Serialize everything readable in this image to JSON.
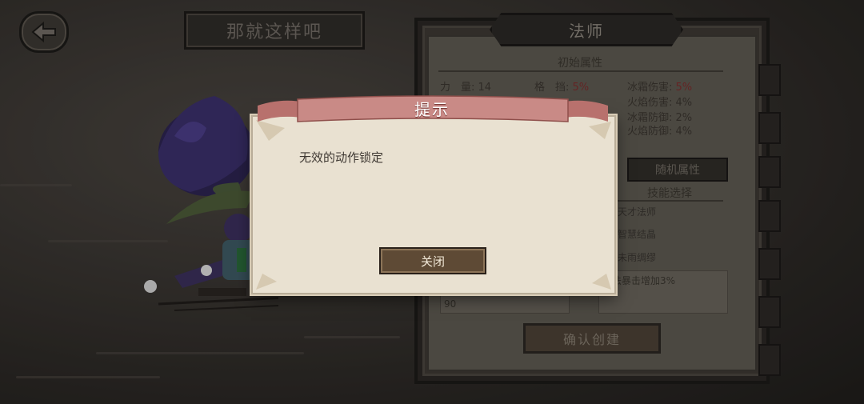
{
  "header": {
    "back_icon": "back-arrow-icon",
    "title": "那就这样吧"
  },
  "panel": {
    "class_name": "法师",
    "initial_attrs_title": "初始属性",
    "stats_left": [
      {
        "label": "力　量:",
        "value": "14"
      },
      {
        "label": "",
        "value": ""
      }
    ],
    "stats_mid": [
      {
        "label": "格　挡:",
        "value": "5%"
      }
    ],
    "stats_right": [
      {
        "label": "冰霜伤害:",
        "value": "5%"
      },
      {
        "label": "火焰伤害:",
        "value": "4%"
      },
      {
        "label": "冰霜防御:",
        "value": "2%"
      },
      {
        "label": "火焰防御:",
        "value": "4%"
      }
    ],
    "random_button": "随机属性",
    "skills_title": "技能选择",
    "skills": [
      "天才法师",
      "智慧结晶",
      "未雨绸缪"
    ],
    "skill_desc": "魔法暴击增加3%",
    "left_desc_value": "90",
    "confirm_button": "确认创建"
  },
  "dialog": {
    "title": "提示",
    "message": "无效的动作锁定",
    "close_button": "关闭"
  },
  "colors": {
    "banner_red": "#c98a86",
    "modal_bg": "#e9e1d1",
    "button_brown": "#5e4a35",
    "stat_red": "#7a2c2c"
  }
}
